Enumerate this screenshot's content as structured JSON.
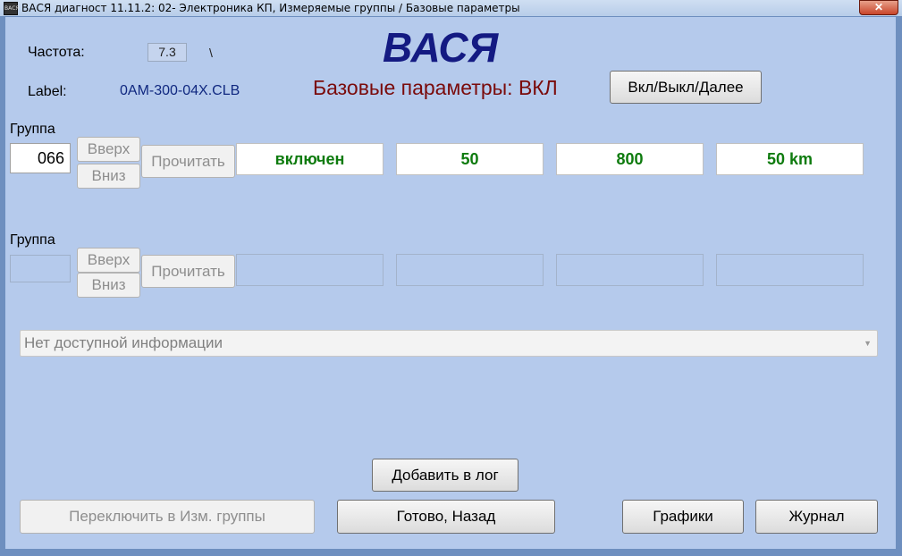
{
  "window": {
    "icon_text": "ВАСЯ",
    "title": "ВАСЯ диагност 11.11.2: 02- Электроника КП,  Измеряемые группы / Базовые параметры",
    "close_glyph": "✕"
  },
  "header": {
    "freq_label": "Частота:",
    "freq_value": "7.3",
    "freq_indicator": "\\",
    "brand": "ВАСЯ",
    "label_label": "Label:",
    "label_value": "0AM-300-04X.CLB",
    "mode_text": "Базовые параметры: ВКЛ",
    "toggle_button": "Вкл/Выкл/Далее"
  },
  "group1": {
    "label": "Группа",
    "number": "066",
    "up": "Вверх",
    "down": "Вниз",
    "read": "Прочитать",
    "values": [
      "включен",
      "50",
      "800",
      "50 km"
    ]
  },
  "group2": {
    "label": "Группа",
    "number": "",
    "up": "Вверх",
    "down": "Вниз",
    "read": "Прочитать",
    "values": [
      "",
      "",
      "",
      ""
    ]
  },
  "info_combo": {
    "text": "Нет доступной информации",
    "arrow": "▼"
  },
  "footer": {
    "add_log": "Добавить в лог",
    "switch": "Переключить в Изм. группы",
    "done": "Готово, Назад",
    "graphs": "Графики",
    "journal": "Журнал"
  },
  "colors": {
    "background": "#b5caec",
    "value_text": "#0e7b0e",
    "brand": "#141a82",
    "mode_text": "#7a0b0b"
  }
}
